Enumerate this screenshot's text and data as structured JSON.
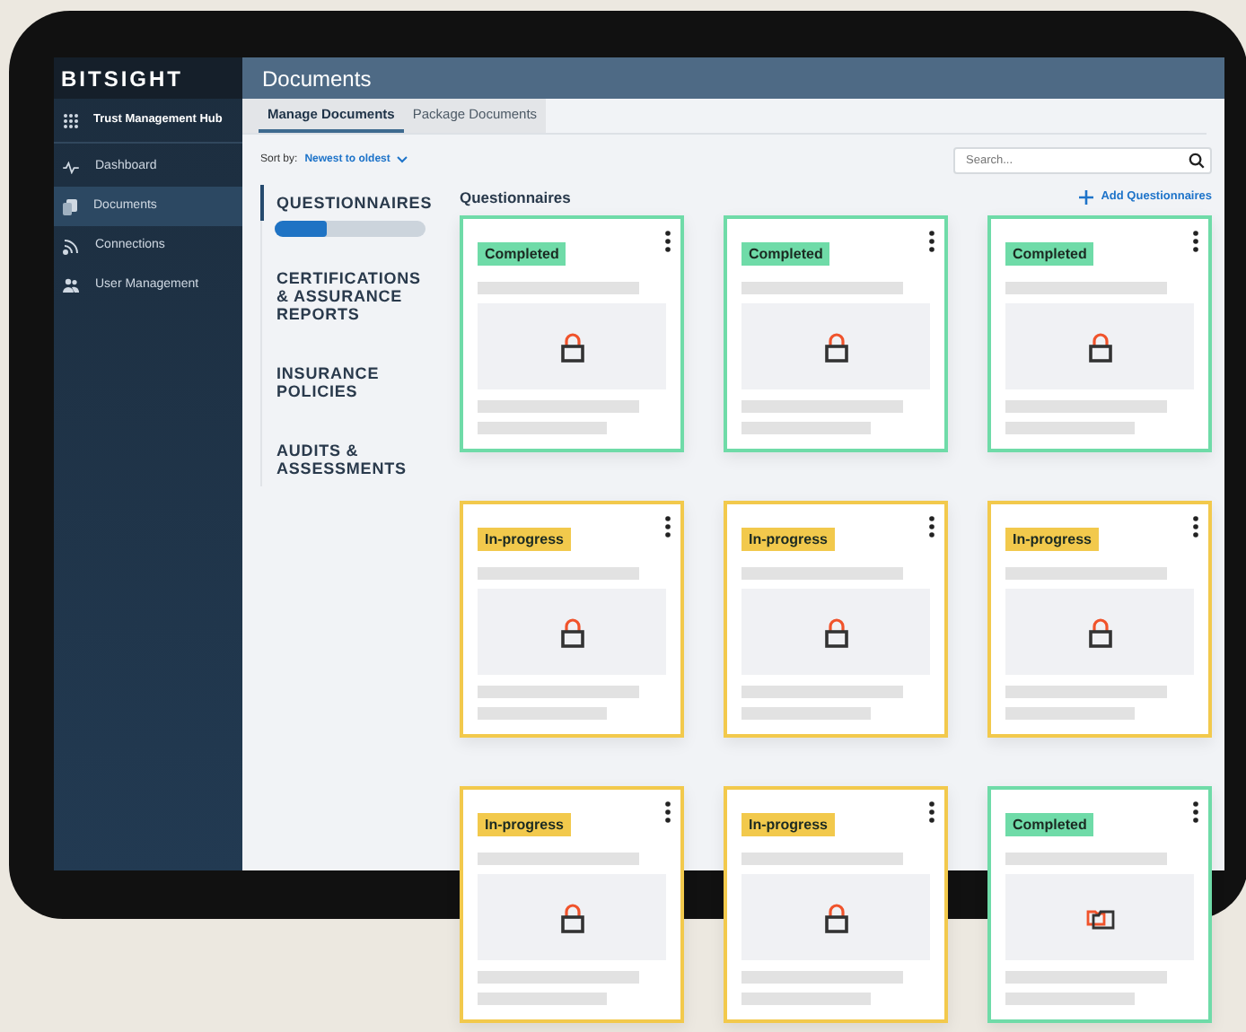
{
  "logo": "BITSIGHT",
  "hub": {
    "label": "Trust Management Hub"
  },
  "sidebar": {
    "items": [
      {
        "label": "Dashboard",
        "selected": false
      },
      {
        "label": "Documents",
        "selected": true
      },
      {
        "label": "Connections",
        "selected": false
      },
      {
        "label": "User Management",
        "selected": false
      }
    ]
  },
  "header": {
    "title": "Documents"
  },
  "tabs": [
    {
      "label": "Manage Documents",
      "selected": true
    },
    {
      "label": "Package Documents",
      "selected": false
    }
  ],
  "sort": {
    "label": "Sort by:",
    "value": "Newest to oldest"
  },
  "search": {
    "placeholder": "Search..."
  },
  "categories": [
    {
      "label": "QUESTIONNAIRES",
      "selected": true,
      "level": 0.35
    },
    {
      "label": "CERTIFICATIONS & ASSURANCE REPORTS",
      "selected": false
    },
    {
      "label": "INSURANCE POLICIES",
      "selected": false
    },
    {
      "label": "AUDITS & ASSESSMENTS",
      "selected": false
    }
  ],
  "section": {
    "title": "Questionnaires",
    "add_button": "Add Questionnaires"
  },
  "documents": [
    {
      "status": "Completed",
      "color": "#6fdba8",
      "kind": "lock"
    },
    {
      "status": "Completed",
      "color": "#6fdba8",
      "kind": "lock"
    },
    {
      "status": "Completed",
      "color": "#6fdba8",
      "kind": "lock"
    },
    {
      "status": "In-progress",
      "color": "#f2c94c",
      "kind": "lock"
    },
    {
      "status": "In-progress",
      "color": "#f2c94c",
      "kind": "lock"
    },
    {
      "status": "In-progress",
      "color": "#f2c94c",
      "kind": "lock"
    },
    {
      "status": "In-progress",
      "color": "#f2c94c",
      "kind": "lock"
    },
    {
      "status": "In-progress",
      "color": "#f2c94c",
      "kind": "lock"
    },
    {
      "status": "Completed",
      "color": "#6fdba8",
      "kind": "folder"
    }
  ]
}
